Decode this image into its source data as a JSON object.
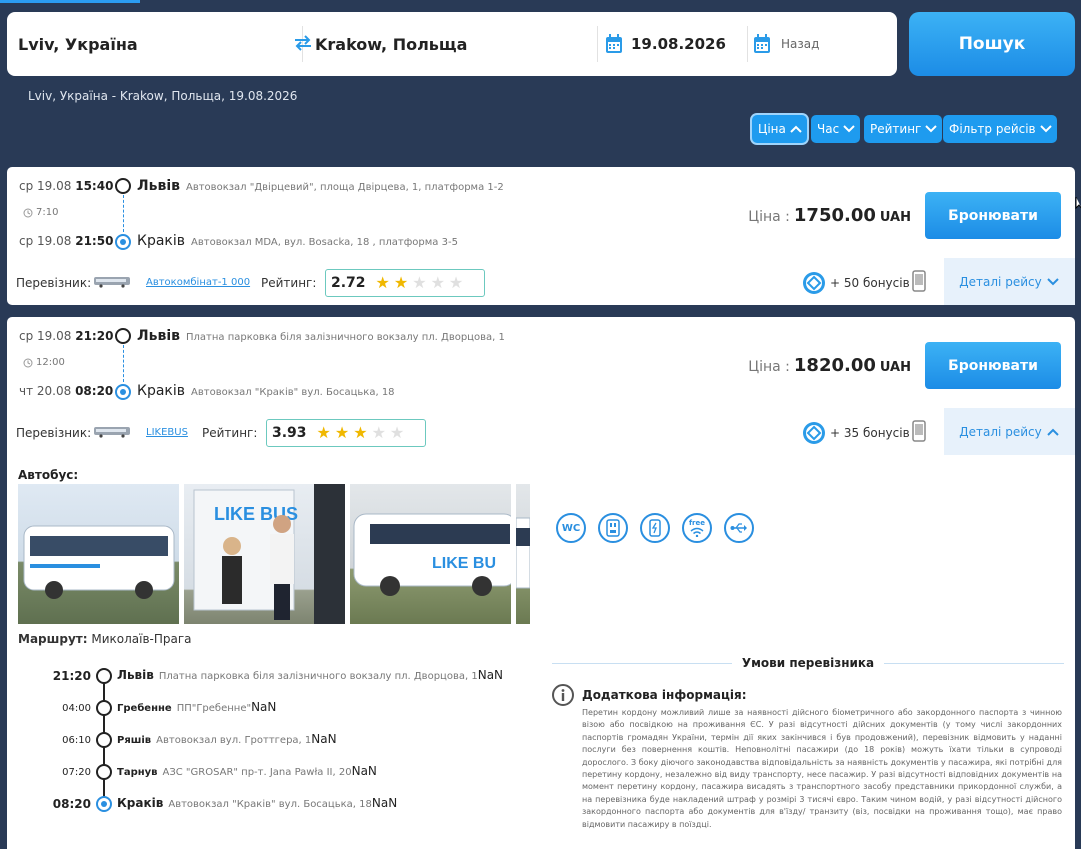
{
  "search": {
    "from": "Lviv, Україна",
    "to": "Krakow, Польща",
    "date": "19.08.2026",
    "back_placeholder": "Назад",
    "submit": "Пошук",
    "route_summary": "Lviv, Україна - Krakow, Польща, 19.08.2026"
  },
  "sort": {
    "price": "Ціна",
    "time": "Час",
    "rating": "Рейтинг",
    "filter": "Фільтр рейсів"
  },
  "labels": {
    "carrier": "Перевізник:",
    "rating": "Рейтинг:",
    "price": "Ціна :",
    "currency": "UAH",
    "book": "Бронювати",
    "details": "Деталі рейсу",
    "bus": "Автобус:",
    "route_label": "Маршрут:",
    "conditions": "Умови перевізника",
    "additional_info": "Додаткова інформація:"
  },
  "trips": [
    {
      "dep_day": "ср 19.08",
      "dep_time": "15:40",
      "dep_city": "Львів",
      "dep_addr": "Автовокзал \"Двірцевий\", площа Двірцева, 1, платформа 1-2",
      "duration": "7:10",
      "arr_day": "ср 19.08",
      "arr_time": "21:50",
      "arr_city": "Краків",
      "arr_addr": "Автовокзал MDA, вул. Bosacka, 18 , платформа 3-5",
      "price": "1750.00",
      "carrier": "Автокомбінат-1 000",
      "rating": "2.72",
      "rating_value": 2.72,
      "bonus": "+ 50 бонусів"
    },
    {
      "dep_day": "ср 19.08",
      "dep_time": "21:20",
      "dep_city": "Львів",
      "dep_addr": "Платна парковка біля залізничного вокзалу пл. Дворцова, 1",
      "duration": "12:00",
      "arr_day": "чт 20.08",
      "arr_time": "08:20",
      "arr_city": "Краків",
      "arr_addr": "Автовокзал \"Краків\" вул. Босацька, 18",
      "price": "1820.00",
      "carrier": "LIKEBUS",
      "rating": "3.93",
      "rating_value": 3.93,
      "bonus": "+ 35 бонусів"
    }
  ],
  "route_name": "Миколаїв-Прага",
  "route_stops": [
    {
      "time": "21:20",
      "city": "Львів",
      "addr": "Платна парковка біля залізничного вокзалу пл. Дворцова, 1",
      "extra": "NaN"
    },
    {
      "time": "04:00",
      "city": "Гребенне",
      "addr": "ПП\"Гребенне\"",
      "extra": "NaN"
    },
    {
      "time": "06:10",
      "city": "Ряшів",
      "addr": "Автовокзал вул. Гроттгера, 1",
      "extra": "NaN"
    },
    {
      "time": "07:20",
      "city": "Тарнув",
      "addr": "АЗС \"GROSAR\" пр-т. Jana Pawła II, 20",
      "extra": "NaN"
    },
    {
      "time": "08:20",
      "city": "Краків",
      "addr": "Автовокзал \"Краків\" вул. Босацька, 18",
      "extra": "NaN"
    }
  ],
  "amenities": [
    "WC",
    "power-socket-icon",
    "phone-charger-icon",
    "free",
    "usb-icon"
  ],
  "amenity_wc": "WC",
  "amenity_free": "free",
  "info_text": "Перетин кордону можливий лише за наявності дійсного біометричного або закордонного паспорта з чинною візою або посвідкою на проживання ЄС. У разі відсутності дійсних документів (у тому числі закордонних паспортів громадян України, термін дії яких закінчився і був продовжений), перевізник відмовить у наданні послуги без повернення коштів. Неповнолітні пасажири (до 18 років) можуть їхати тільки в супроводі дорослого. З боку діючого законодавства відповідальність за наявність документів у пасажира, які потрібні для перетину кордону, незалежно від виду транспорту, несе пасажир. У разі відсутності відповідних документів на момент перетину кордону, пасажира висадять з транспортного засобу представники прикордонної служби, а на перевізника буде накладений штраф у розмірі 3 тисячі євро. Таким чином водій, у разі відсутності дійсного закордонного паспорта або документів для в'їзду/ транзиту (віз, посвідки на проживання тощо), має право відмовити пасажиру в поїздці.",
  "colors": {
    "bg": "#293a56",
    "accent": "#1e9bef",
    "link": "#2a8fe0",
    "star": "#f0b800"
  }
}
